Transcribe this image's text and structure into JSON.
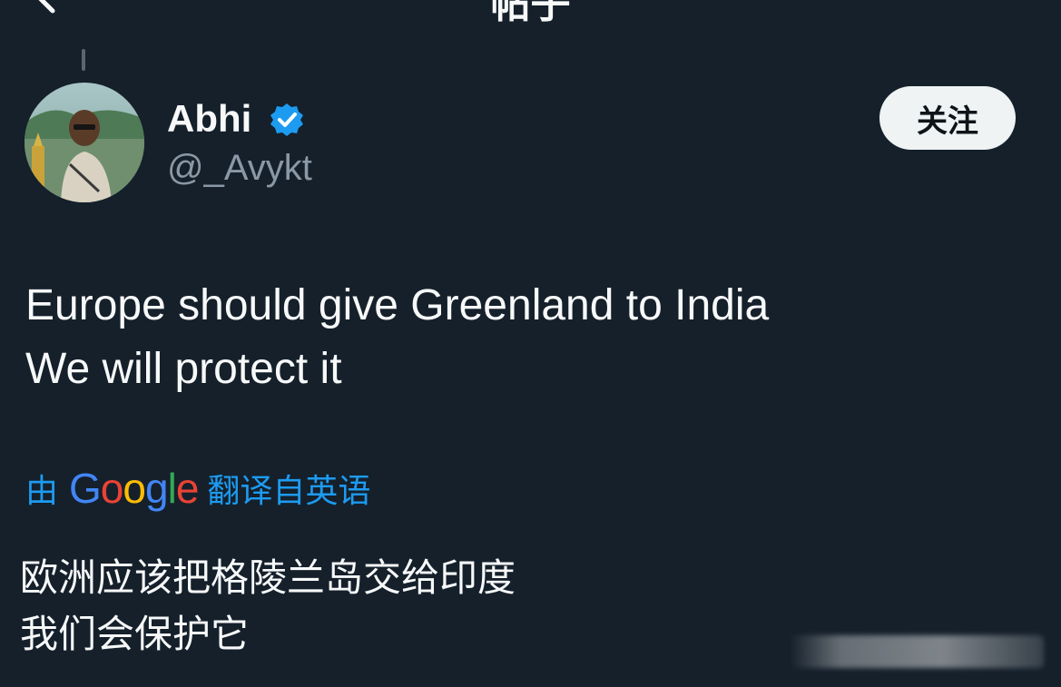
{
  "header": {
    "title": "帖子",
    "back_icon": "chevron-left-icon"
  },
  "author": {
    "display_name": "Abhi",
    "handle": "@_Avykt",
    "verified_icon": "verified-badge-icon",
    "verified_color": "#1d9bf0"
  },
  "follow_button": {
    "label": "关注"
  },
  "tweet": {
    "lines": [
      "Europe should give Greenland to India",
      "We will protect it"
    ]
  },
  "translation": {
    "prefix": "由",
    "provider": "Google",
    "suffix": "翻译自英语",
    "lines": [
      "欧洲应该把格陵兰岛交给印度",
      "我们会保护它"
    ]
  },
  "colors": {
    "background": "#15202b",
    "link": "#1d9bf0",
    "secondary_text": "#8b98a5"
  }
}
